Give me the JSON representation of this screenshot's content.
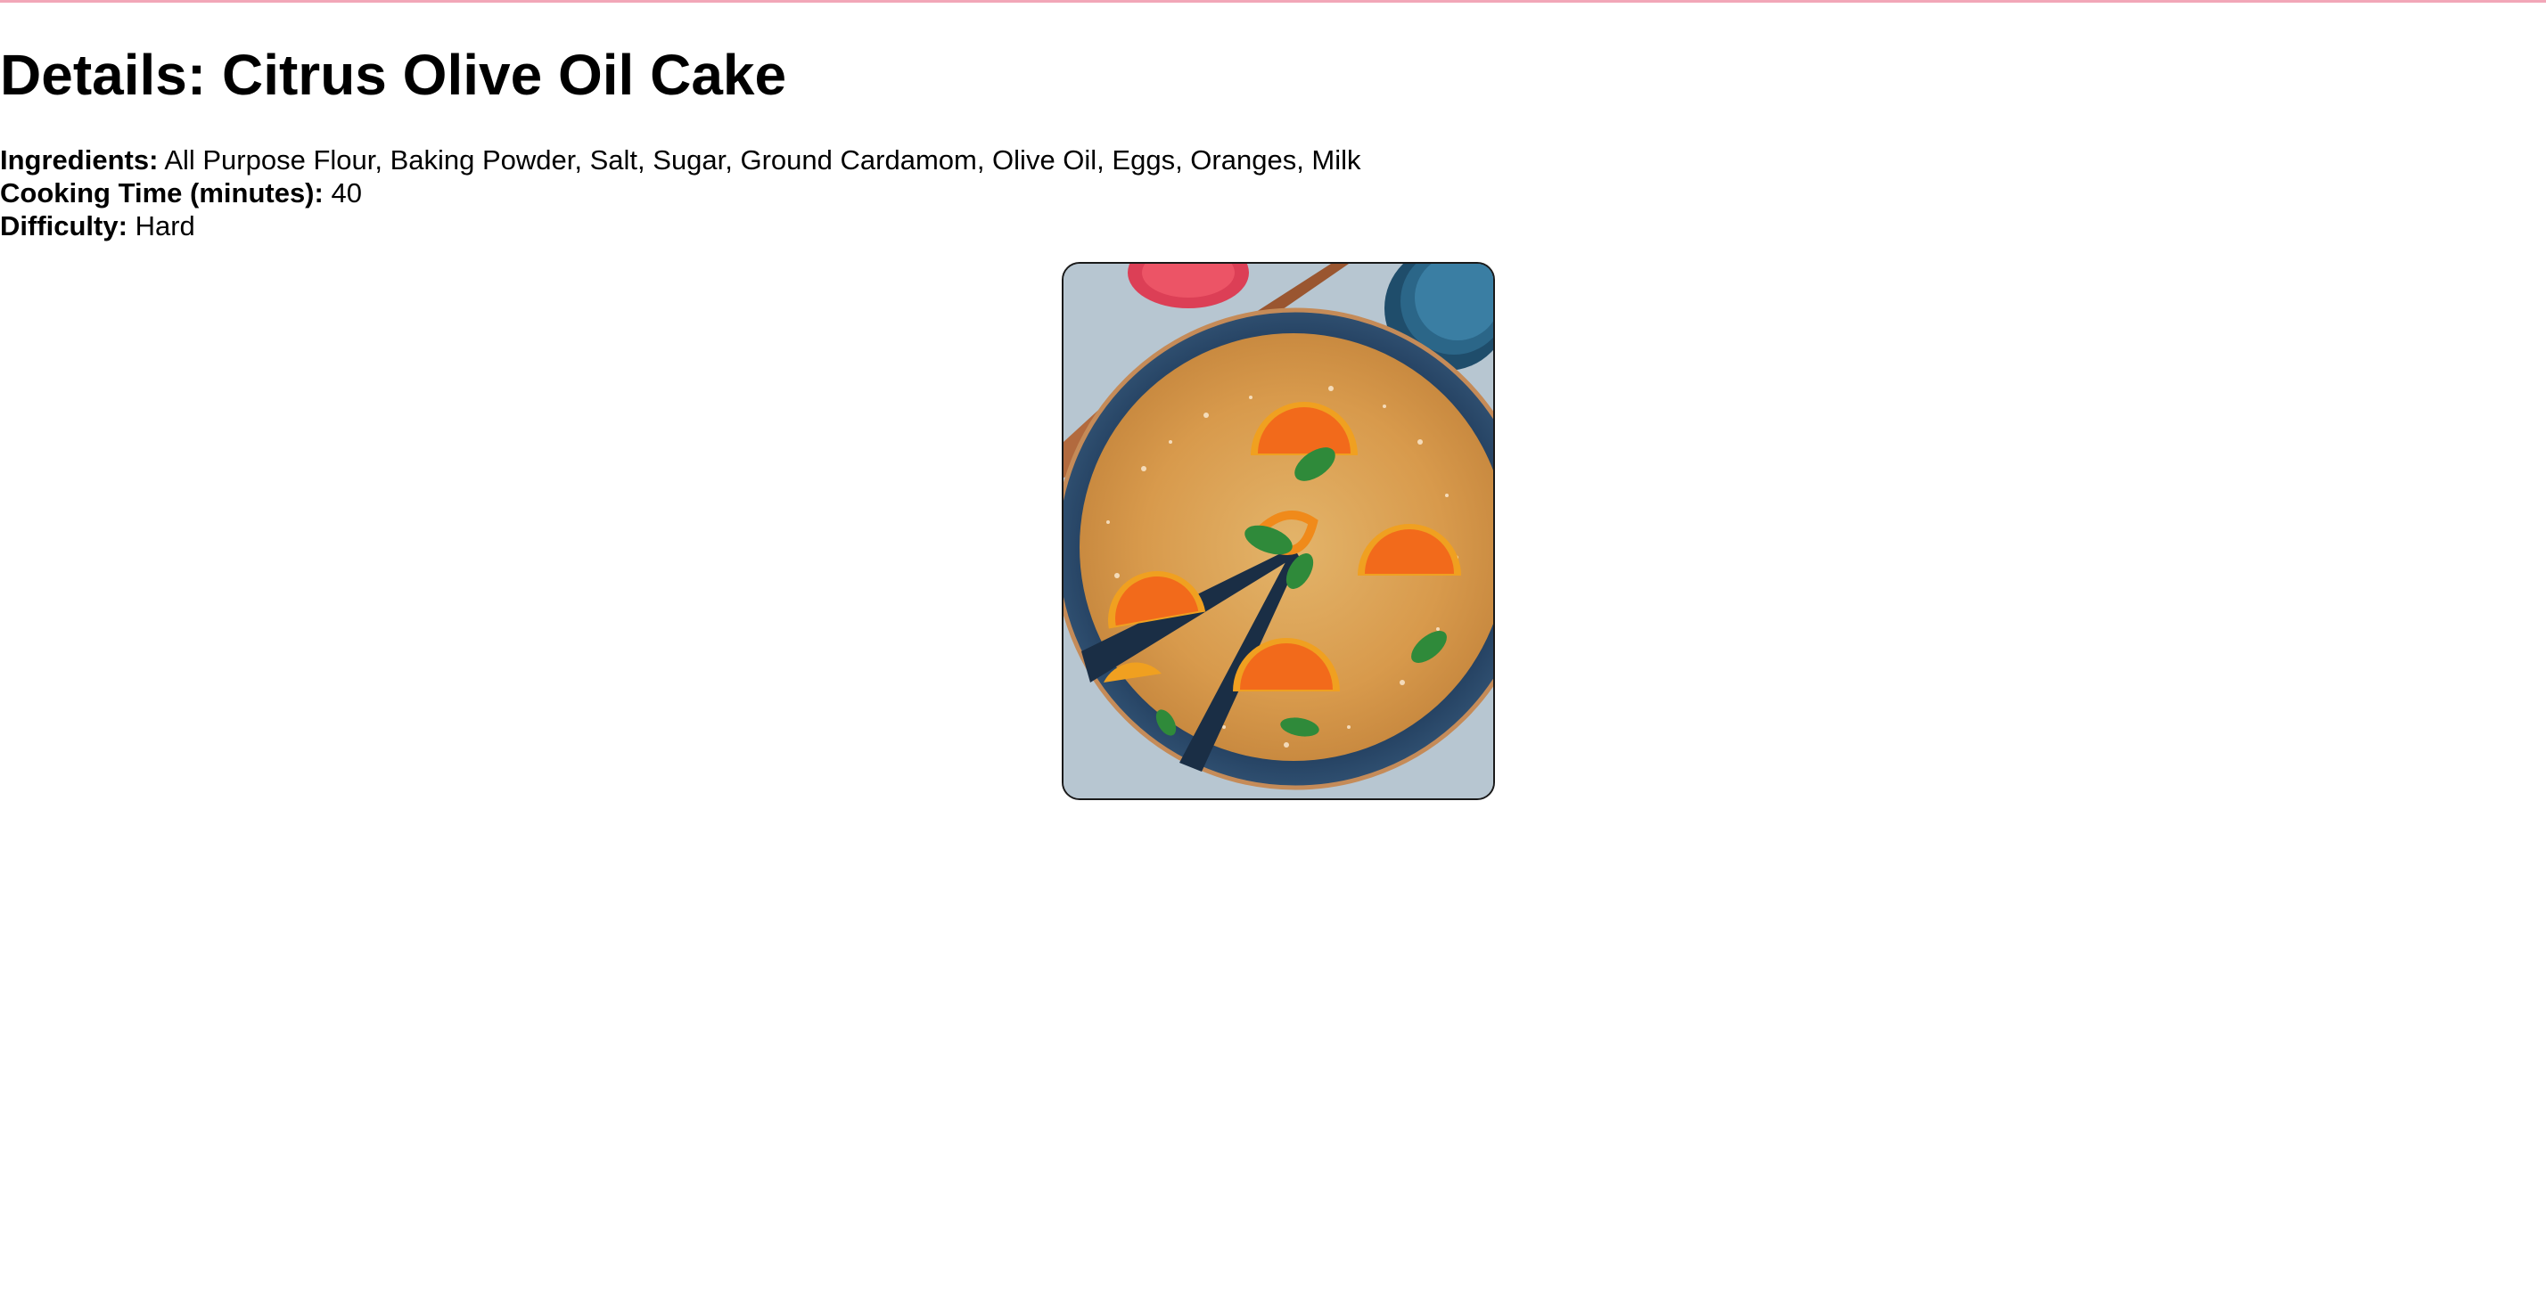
{
  "recipe": {
    "title": "Details: Citrus Olive Oil Cake",
    "ingredients_label": "Ingredients:",
    "ingredients": "All Purpose Flour, Baking Powder, Salt, Sugar, Ground Cardamom, Olive Oil, Eggs, Oranges, Milk",
    "cooking_time_label": "Cooking Time (minutes):",
    "cooking_time": "40",
    "difficulty_label": "Difficulty:",
    "difficulty": "Hard"
  },
  "image": {
    "subject": "citrus-olive-oil-cake-photo"
  },
  "colors": {
    "top_rule": "#f2a7b8",
    "text": "#000000",
    "background": "#ffffff"
  }
}
